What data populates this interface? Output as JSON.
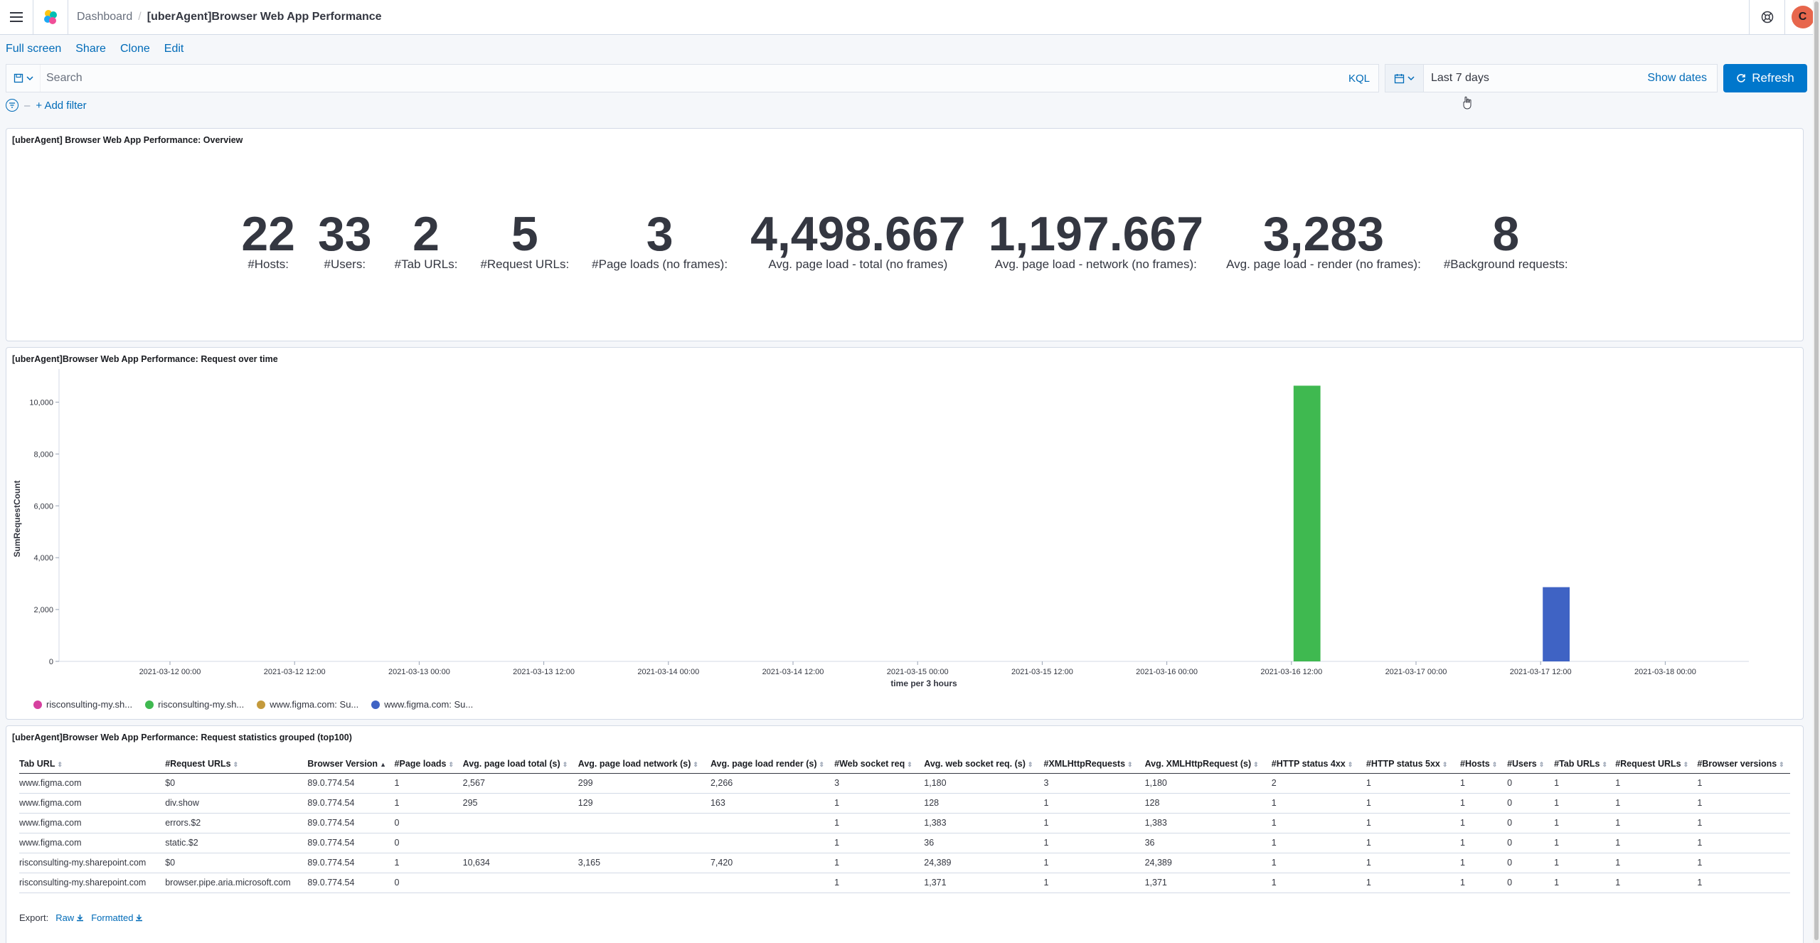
{
  "header": {
    "breadcrumbs": [
      "Dashboard",
      "[uberAgent]Browser Web App Performance"
    ],
    "separator": "/",
    "avatar_initial": "C"
  },
  "topnav": [
    "Full screen",
    "Share",
    "Clone",
    "Edit"
  ],
  "query": {
    "search_placeholder": "Search",
    "language": "KQL",
    "date_range": "Last 7 days",
    "show_dates": "Show dates",
    "refresh": "Refresh",
    "add_filter": "+ Add filter"
  },
  "overview": {
    "title": "[uberAgent] Browser Web App Performance: Overview",
    "metrics": [
      {
        "value": "22",
        "label": "#Hosts:"
      },
      {
        "value": "33",
        "label": "#Users:"
      },
      {
        "value": "2",
        "label": "#Tab URLs:"
      },
      {
        "value": "5",
        "label": "#Request URLs:"
      },
      {
        "value": "3",
        "label": "#Page loads (no frames):"
      },
      {
        "value": "4,498.667",
        "label": "Avg. page load - total (no frames)"
      },
      {
        "value": "1,197.667",
        "label": "Avg. page load - network (no frames):"
      },
      {
        "value": "3,283",
        "label": "Avg. page load - render (no frames):"
      },
      {
        "value": "8",
        "label": "#Background requests:"
      }
    ]
  },
  "request_chart": {
    "title": "[uberAgent]Browser Web App Performance: Request over time",
    "legend": [
      {
        "label": "risconsulting-my.sh...",
        "color": "#d6409f"
      },
      {
        "label": "risconsulting-my.sh...",
        "color": "#3fb950"
      },
      {
        "label": "www.figma.com: Su...",
        "color": "#c49a3c"
      },
      {
        "label": "www.figma.com: Su...",
        "color": "#3f63c4"
      }
    ]
  },
  "chart_data": {
    "type": "bar",
    "xlabel": "time per 3 hours",
    "ylabel": "SumRequestCount",
    "ylim": [
      0,
      11000
    ],
    "yticks": [
      0,
      2000,
      4000,
      6000,
      8000,
      10000
    ],
    "ytick_labels": [
      "0",
      "2,000",
      "4,000",
      "6,000",
      "8,000",
      "10,000"
    ],
    "xticks": [
      "2021-03-12 00:00",
      "2021-03-12 12:00",
      "2021-03-13 00:00",
      "2021-03-13 12:00",
      "2021-03-14 00:00",
      "2021-03-14 12:00",
      "2021-03-15 00:00",
      "2021-03-15 12:00",
      "2021-03-16 00:00",
      "2021-03-16 12:00",
      "2021-03-17 00:00",
      "2021-03-17 12:00",
      "2021-03-18 00:00"
    ],
    "x_start": "2021-03-12 00:00",
    "bar_hours": 3,
    "grid": false,
    "legend_position": "bottom",
    "bars": [
      {
        "x": "2021-03-16 12:00",
        "value": 10634,
        "series": 1
      },
      {
        "x": "2021-03-17 12:00",
        "value": 2863,
        "series": 3
      }
    ]
  },
  "stats_table": {
    "title": "[uberAgent]Browser Web App Performance: Request statistics grouped (top100)",
    "columns": [
      "Tab URL",
      "#Request URLs",
      "Browser Version",
      "#Page loads",
      "Avg. page load total (s)",
      "Avg. page load network (s)",
      "Avg. page load render (s)",
      "#Web socket req",
      "Avg. web socket req. (s)",
      "#XMLHttpRequests",
      "Avg. XMLHttpRequest (s)",
      "#HTTP status 4xx",
      "#HTTP status 5xx",
      "#Hosts",
      "#Users",
      "#Tab URLs",
      "#Request URLs",
      "#Browser versions"
    ],
    "rows": [
      [
        "www.figma.com",
        "$0",
        "89.0.774.54",
        "1",
        "2,567",
        "299",
        "2,266",
        "3",
        "1,180",
        "3",
        "1,180",
        "2",
        "1",
        "1",
        "0",
        "1",
        "1",
        "1"
      ],
      [
        "www.figma.com",
        "div.show",
        "89.0.774.54",
        "1",
        "295",
        "129",
        "163",
        "1",
        "128",
        "1",
        "128",
        "1",
        "1",
        "1",
        "0",
        "1",
        "1",
        "1"
      ],
      [
        "www.figma.com",
        "errors.$2",
        "89.0.774.54",
        "0",
        "",
        "",
        "",
        "1",
        "1,383",
        "1",
        "1,383",
        "1",
        "1",
        "1",
        "0",
        "1",
        "1",
        "1"
      ],
      [
        "www.figma.com",
        "static.$2",
        "89.0.774.54",
        "0",
        "",
        "",
        "",
        "1",
        "36",
        "1",
        "36",
        "1",
        "1",
        "1",
        "0",
        "1",
        "1",
        "1"
      ],
      [
        "risconsulting-my.sharepoint.com",
        "$0",
        "89.0.774.54",
        "1",
        "10,634",
        "3,165",
        "7,420",
        "1",
        "24,389",
        "1",
        "24,389",
        "1",
        "1",
        "1",
        "0",
        "1",
        "1",
        "1"
      ],
      [
        "risconsulting-my.sharepoint.com",
        "browser.pipe.aria.microsoft.com",
        "89.0.774.54",
        "0",
        "",
        "",
        "",
        "1",
        "1,371",
        "1",
        "1,371",
        "1",
        "1",
        "1",
        "0",
        "1",
        "1",
        "1"
      ]
    ],
    "export_label": "Export:",
    "export_raw": "Raw",
    "export_formatted": "Formatted"
  }
}
